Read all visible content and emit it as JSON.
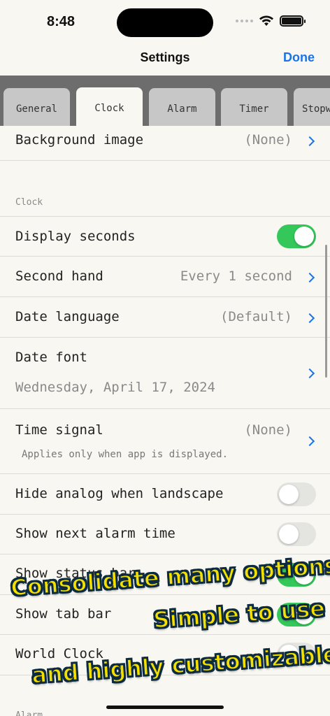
{
  "status_bar": {
    "time": "8:48"
  },
  "nav": {
    "title": "Settings",
    "done_label": "Done"
  },
  "tabs": [
    "General",
    "Clock",
    "Alarm",
    "Timer",
    "Stopw"
  ],
  "active_tab": "Clock",
  "background_row": {
    "label": "Background image",
    "value": "(None)"
  },
  "section_clock": "Clock",
  "rows": {
    "display_seconds": {
      "label": "Display seconds",
      "on": true
    },
    "second_hand": {
      "label": "Second hand",
      "value": "Every 1 second"
    },
    "date_language": {
      "label": "Date language",
      "value": "(Default)"
    },
    "date_font": {
      "label": "Date font",
      "sample": "Wednesday, April 17, 2024"
    },
    "time_signal": {
      "label": "Time signal",
      "value": "(None)",
      "note": "Applies only when app is displayed."
    },
    "hide_analog": {
      "label": "Hide analog when landscape",
      "on": false
    },
    "show_next_alarm": {
      "label": "Show next alarm time",
      "on": false
    },
    "show_status_bar": {
      "label": "Show status bar",
      "on": true
    },
    "show_tab_bar": {
      "label": "Show tab bar",
      "on": true
    },
    "world_clock": {
      "label": "World Clock",
      "on": false
    }
  },
  "section_alarm": "Alarm",
  "promo": {
    "line1": "Consolidate many options",
    "line2": "Simple to use",
    "line3": "and highly customizable"
  },
  "colors": {
    "accent": "#1a73e8",
    "toggle_on": "#34c759",
    "promo_text": "#f4e000"
  }
}
